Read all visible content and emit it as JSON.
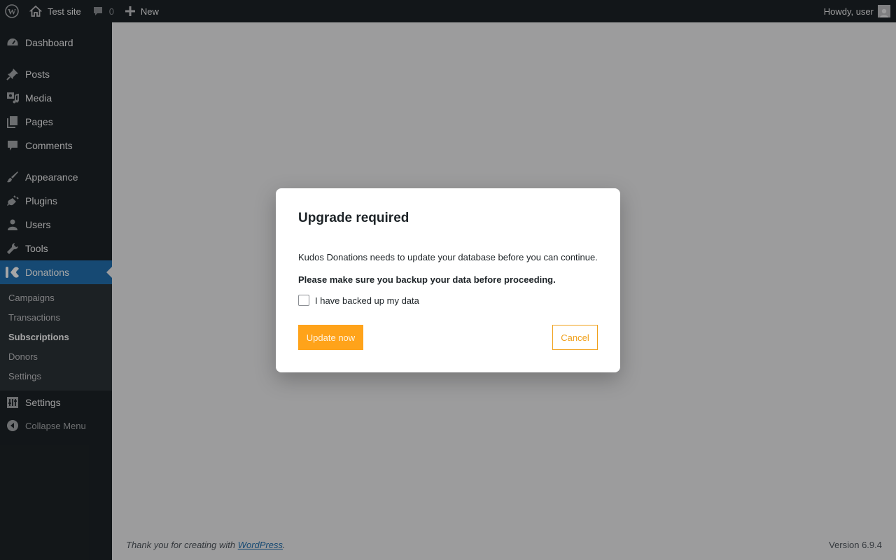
{
  "admin_bar": {
    "site_name": "Test site",
    "comments_count": "0",
    "new_label": "New",
    "greeting": "Howdy, user"
  },
  "sidebar": {
    "items": [
      {
        "label": "Dashboard",
        "icon": "dashboard-icon"
      },
      {
        "label": "Posts",
        "icon": "pin-icon"
      },
      {
        "label": "Media",
        "icon": "media-icon"
      },
      {
        "label": "Pages",
        "icon": "pages-icon"
      },
      {
        "label": "Comments",
        "icon": "comment-icon"
      },
      {
        "label": "Appearance",
        "icon": "brush-icon"
      },
      {
        "label": "Plugins",
        "icon": "plug-icon"
      },
      {
        "label": "Users",
        "icon": "user-icon"
      },
      {
        "label": "Tools",
        "icon": "wrench-icon"
      },
      {
        "label": "Donations",
        "icon": "kudos-icon"
      },
      {
        "label": "Settings",
        "icon": "settings-icon"
      }
    ],
    "submenu": [
      "Campaigns",
      "Transactions",
      "Subscriptions",
      "Donors",
      "Settings"
    ],
    "collapse_label": "Collapse Menu",
    "colors": {
      "background": "#1d2327",
      "current": "#2271b1",
      "submenu_bg": "#2c3338"
    }
  },
  "footer": {
    "thanks_prefix": "Thank you for creating with ",
    "link_text": "WordPress",
    "thanks_suffix": ".",
    "version": "Version 6.9.4"
  },
  "modal": {
    "title": "Upgrade required",
    "description": "Kudos Donations needs to update your database before you can continue.",
    "warning": "Please make sure you backup your data before proceeding.",
    "checkbox_label": "I have backed up my data",
    "checkbox_checked": false,
    "primary_button": "Update now",
    "secondary_button": "Cancel",
    "accent_color": "#ffa31a"
  }
}
